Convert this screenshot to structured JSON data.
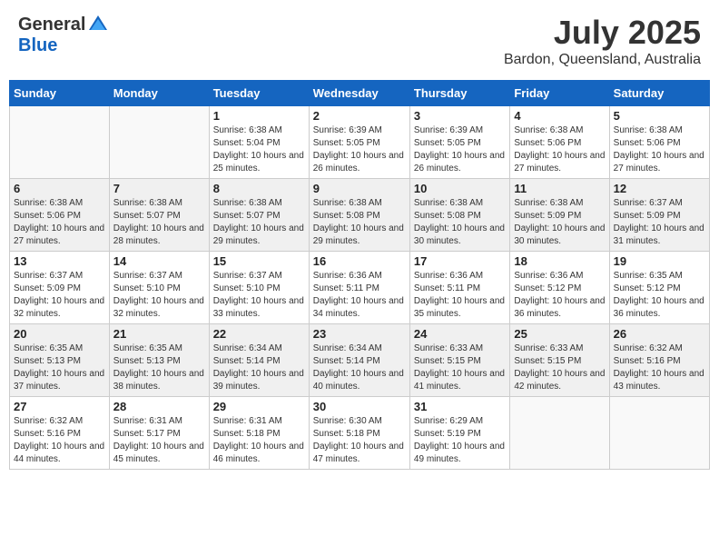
{
  "header": {
    "logo_general": "General",
    "logo_blue": "Blue",
    "month_year": "July 2025",
    "location": "Bardon, Queensland, Australia"
  },
  "weekdays": [
    "Sunday",
    "Monday",
    "Tuesday",
    "Wednesday",
    "Thursday",
    "Friday",
    "Saturday"
  ],
  "weeks": [
    {
      "shaded": false,
      "days": [
        {
          "num": "",
          "empty": true
        },
        {
          "num": "",
          "empty": true
        },
        {
          "num": "1",
          "sunrise": "6:38 AM",
          "sunset": "5:04 PM",
          "daylight": "10 hours and 25 minutes."
        },
        {
          "num": "2",
          "sunrise": "6:39 AM",
          "sunset": "5:05 PM",
          "daylight": "10 hours and 26 minutes."
        },
        {
          "num": "3",
          "sunrise": "6:39 AM",
          "sunset": "5:05 PM",
          "daylight": "10 hours and 26 minutes."
        },
        {
          "num": "4",
          "sunrise": "6:38 AM",
          "sunset": "5:06 PM",
          "daylight": "10 hours and 27 minutes."
        },
        {
          "num": "5",
          "sunrise": "6:38 AM",
          "sunset": "5:06 PM",
          "daylight": "10 hours and 27 minutes."
        }
      ]
    },
    {
      "shaded": true,
      "days": [
        {
          "num": "6",
          "sunrise": "6:38 AM",
          "sunset": "5:06 PM",
          "daylight": "10 hours and 27 minutes."
        },
        {
          "num": "7",
          "sunrise": "6:38 AM",
          "sunset": "5:07 PM",
          "daylight": "10 hours and 28 minutes."
        },
        {
          "num": "8",
          "sunrise": "6:38 AM",
          "sunset": "5:07 PM",
          "daylight": "10 hours and 29 minutes."
        },
        {
          "num": "9",
          "sunrise": "6:38 AM",
          "sunset": "5:08 PM",
          "daylight": "10 hours and 29 minutes."
        },
        {
          "num": "10",
          "sunrise": "6:38 AM",
          "sunset": "5:08 PM",
          "daylight": "10 hours and 30 minutes."
        },
        {
          "num": "11",
          "sunrise": "6:38 AM",
          "sunset": "5:09 PM",
          "daylight": "10 hours and 30 minutes."
        },
        {
          "num": "12",
          "sunrise": "6:37 AM",
          "sunset": "5:09 PM",
          "daylight": "10 hours and 31 minutes."
        }
      ]
    },
    {
      "shaded": false,
      "days": [
        {
          "num": "13",
          "sunrise": "6:37 AM",
          "sunset": "5:09 PM",
          "daylight": "10 hours and 32 minutes."
        },
        {
          "num": "14",
          "sunrise": "6:37 AM",
          "sunset": "5:10 PM",
          "daylight": "10 hours and 32 minutes."
        },
        {
          "num": "15",
          "sunrise": "6:37 AM",
          "sunset": "5:10 PM",
          "daylight": "10 hours and 33 minutes."
        },
        {
          "num": "16",
          "sunrise": "6:36 AM",
          "sunset": "5:11 PM",
          "daylight": "10 hours and 34 minutes."
        },
        {
          "num": "17",
          "sunrise": "6:36 AM",
          "sunset": "5:11 PM",
          "daylight": "10 hours and 35 minutes."
        },
        {
          "num": "18",
          "sunrise": "6:36 AM",
          "sunset": "5:12 PM",
          "daylight": "10 hours and 36 minutes."
        },
        {
          "num": "19",
          "sunrise": "6:35 AM",
          "sunset": "5:12 PM",
          "daylight": "10 hours and 36 minutes."
        }
      ]
    },
    {
      "shaded": true,
      "days": [
        {
          "num": "20",
          "sunrise": "6:35 AM",
          "sunset": "5:13 PM",
          "daylight": "10 hours and 37 minutes."
        },
        {
          "num": "21",
          "sunrise": "6:35 AM",
          "sunset": "5:13 PM",
          "daylight": "10 hours and 38 minutes."
        },
        {
          "num": "22",
          "sunrise": "6:34 AM",
          "sunset": "5:14 PM",
          "daylight": "10 hours and 39 minutes."
        },
        {
          "num": "23",
          "sunrise": "6:34 AM",
          "sunset": "5:14 PM",
          "daylight": "10 hours and 40 minutes."
        },
        {
          "num": "24",
          "sunrise": "6:33 AM",
          "sunset": "5:15 PM",
          "daylight": "10 hours and 41 minutes."
        },
        {
          "num": "25",
          "sunrise": "6:33 AM",
          "sunset": "5:15 PM",
          "daylight": "10 hours and 42 minutes."
        },
        {
          "num": "26",
          "sunrise": "6:32 AM",
          "sunset": "5:16 PM",
          "daylight": "10 hours and 43 minutes."
        }
      ]
    },
    {
      "shaded": false,
      "days": [
        {
          "num": "27",
          "sunrise": "6:32 AM",
          "sunset": "5:16 PM",
          "daylight": "10 hours and 44 minutes."
        },
        {
          "num": "28",
          "sunrise": "6:31 AM",
          "sunset": "5:17 PM",
          "daylight": "10 hours and 45 minutes."
        },
        {
          "num": "29",
          "sunrise": "6:31 AM",
          "sunset": "5:18 PM",
          "daylight": "10 hours and 46 minutes."
        },
        {
          "num": "30",
          "sunrise": "6:30 AM",
          "sunset": "5:18 PM",
          "daylight": "10 hours and 47 minutes."
        },
        {
          "num": "31",
          "sunrise": "6:29 AM",
          "sunset": "5:19 PM",
          "daylight": "10 hours and 49 minutes."
        },
        {
          "num": "",
          "empty": true
        },
        {
          "num": "",
          "empty": true
        }
      ]
    }
  ]
}
